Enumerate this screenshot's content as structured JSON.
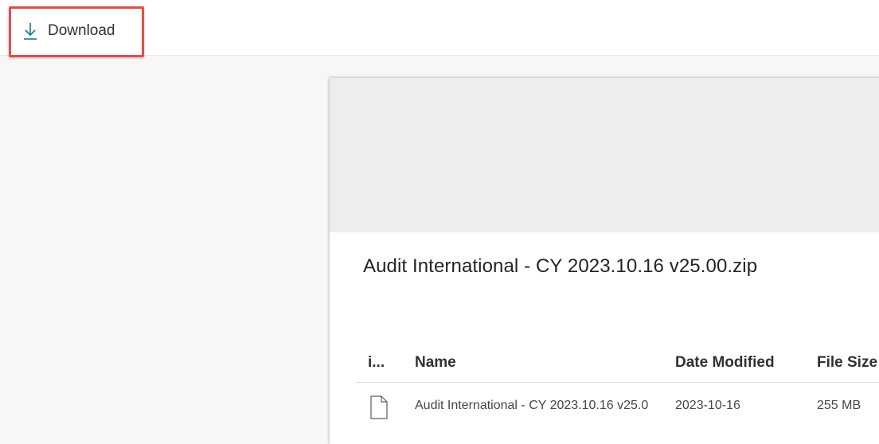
{
  "toolbar": {
    "download_label": "Download",
    "download_icon": "download-arrow-icon"
  },
  "file": {
    "title": "Audit International - CY 2023.10.16 v25.00.zip"
  },
  "table": {
    "headers": {
      "icon": "i...",
      "name": "Name",
      "date": "Date Modified",
      "size": "File Size"
    },
    "rows": [
      {
        "icon": "file-icon",
        "name": "Audit International - CY 2023.10.16 v25.0",
        "date": "2023-10-16",
        "size": "255 MB"
      }
    ]
  },
  "colors": {
    "accent": "#0f7d8c",
    "highlight": "#e14d4d"
  }
}
